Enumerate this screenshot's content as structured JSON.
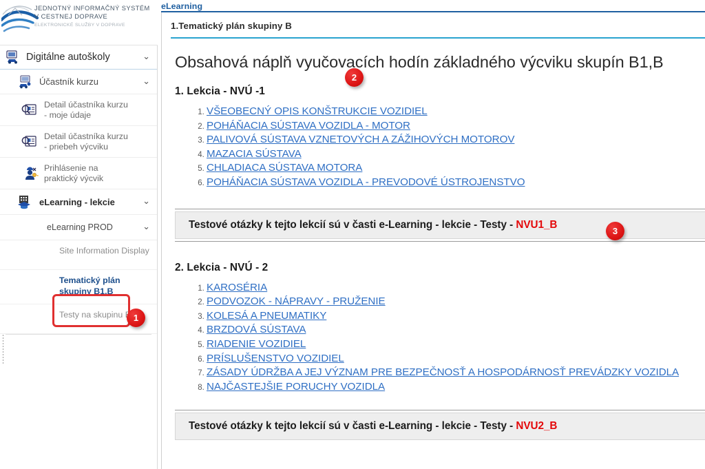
{
  "logo": {
    "line1": "JEDNOTNÝ INFORMAČNÝ SYSTÉM",
    "line2": "V CESTNEJ DOPRAVE",
    "line3": "ELEKTRONICKÉ SLUŽBY V DOPRAVE",
    "icon": "jisc-swoosh-logo"
  },
  "sidebar": {
    "root": {
      "label": "Digitálne autoškoly",
      "icon": "car-monitor-icon",
      "chevron": "chevron-down-icon"
    },
    "level1": {
      "label": "Účastník kurzu",
      "icon": "computer-user-icon",
      "chevron": "chevron-down-icon"
    },
    "items": [
      {
        "label": "Detail účastníka kurzu - moje údaje",
        "icon": "id-card-search-icon"
      },
      {
        "label": "Detail účastníka kurzu - priebeh výcviku",
        "icon": "id-card-search-icon"
      },
      {
        "label": "Prihlásenie na praktický výcvik",
        "icon": "worker-key-icon"
      }
    ],
    "elearning": {
      "label": "eLearning - lekcie",
      "icon": "building-graduation-icon",
      "chevron": "chevron-down-icon"
    },
    "prod": {
      "label": "eLearning PROD",
      "chevron": "chevron-down-icon"
    },
    "leaves": [
      {
        "label": "Site Information Display",
        "active": false
      },
      {
        "label": "Tematický plán skupiny B1,B",
        "active": true
      },
      {
        "label": "Testy na skupinu B1,B",
        "active": false
      }
    ]
  },
  "main": {
    "tab": "eLearning",
    "panel_title": "1.Tematický plán skupiny B",
    "heading": "Obsahová náplň vyučovacích hodín základného výcviku skupín B1,B",
    "sections": [
      {
        "heading": "1. Lekcia - NVÚ -1",
        "links": [
          "VŠEOBECNÝ OPIS KONŠTRUKCIE VOZIDIEL",
          "POHÁŇACIA SÚSTAVA VOZIDLA - MOTOR ",
          "PALIVOVÁ SÚSTAVA VZNETOVÝCH A ZÁŽIHOVÝCH MOTOROV ",
          "MAZACIA SÚSTAVA",
          "CHLADIACA SÚSTAVA MOTORA",
          "POHÁŇACIA SÚSTAVA VOZIDLA - PREVODOVÉ ÚSTROJENSTVO "
        ],
        "testbar_text": "Testové otázky k tejto lekcií sú v časti e-Learning - lekcie - Testy - ",
        "testbar_code": "NVU1_B"
      },
      {
        "heading": "2. Lekcia - NVÚ - 2",
        "links": [
          "KAROSÉRIA ",
          "PODVOZOK - NÁPRAVY - PRUŽENIE",
          "KOLESÁ A PNEUMATIKY",
          "BRZDOVÁ SÚSTAVA ",
          "RIADENIE VOZIDIEL ",
          "PRÍSLUŠENSTVO VOZIDIEL",
          "ZÁSADY ÚDRŽBA A JEJ VÝZNAM PRE BEZPEČNOSŤ A HOSPODÁRNOSŤ PREVÁDZKY VOZIDLA ",
          "NAJČASTEJŠIE PORUCHY VOZIDLA"
        ],
        "testbar_text": "Testové otázky k tejto lekcií sú v časti e-Learning - lekcie - Testy - ",
        "testbar_code": "NVU2_B"
      }
    ]
  },
  "badges": [
    {
      "number": "1"
    },
    {
      "number": "2"
    },
    {
      "number": "3"
    }
  ],
  "colors": {
    "accent_blue": "#1f5fa0",
    "rule_cyan": "#29a3cf",
    "link_blue": "#2f6fc4",
    "badge_red": "#dc1414",
    "code_red": "#e4080a",
    "highlight_red": "#e03030"
  }
}
